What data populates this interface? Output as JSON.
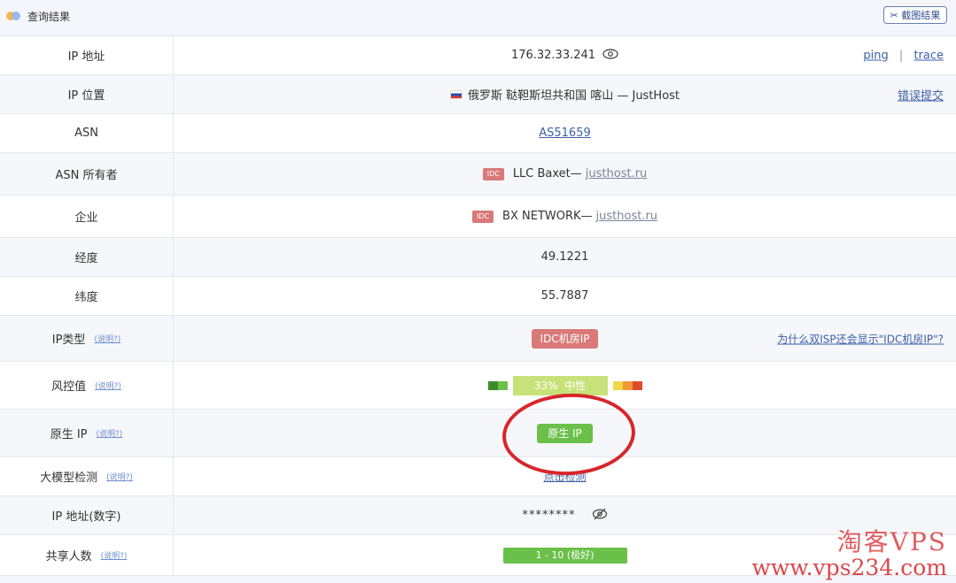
{
  "header": {
    "title": "查询结果",
    "screenshot_button": "截图结果"
  },
  "rows": {
    "ip": {
      "label": "IP 地址",
      "value": "176.32.33.241",
      "ping": "ping",
      "sep": "|",
      "trace": "trace"
    },
    "location": {
      "label": "IP 位置",
      "value": "俄罗斯 鞑靼斯坦共和国 喀山 — JustHost",
      "report": "错误提交"
    },
    "asn": {
      "label": "ASN",
      "value": "AS51659"
    },
    "asn_owner": {
      "label": "ASN 所有者",
      "badge": "IDC",
      "name": "LLC Baxet—",
      "domain": "justhost.ru"
    },
    "enterprise": {
      "label": "企业",
      "badge": "IDC",
      "name": "BX NETWORK—",
      "domain": "justhost.ru"
    },
    "longitude": {
      "label": "经度",
      "value": "49.1221"
    },
    "latitude": {
      "label": "纬度",
      "value": "55.7887"
    },
    "ip_type": {
      "label": "IP类型",
      "help": "(说明?)",
      "value": "IDC机房IP",
      "question": "为什么双ISP还会显示\"IDC机房IP\"?"
    },
    "risk": {
      "label": "风控值",
      "help": "(说明?)",
      "score": "33%",
      "level": "中性",
      "fraction": 0.33
    },
    "native": {
      "label": "原生 IP",
      "help": "(说明?)",
      "value": "原生 IP"
    },
    "llm": {
      "label": "大模型检测",
      "help": "(说明?)",
      "value": "点击检测"
    },
    "ip_numeric": {
      "label": "IP 地址(数字)",
      "value": "********"
    },
    "shared": {
      "label": "共享人数",
      "help": "(说明?)",
      "value": "1 - 10 (极好)"
    }
  },
  "watermark": {
    "top": "淘客VPS",
    "bottom": "www.vps234.com"
  },
  "colors": {
    "idc": "#d97a78",
    "green": "#6bc04a",
    "risk_mid": "#c8e27a",
    "annotation": "#d8262b",
    "link": "#3d5fa8"
  }
}
